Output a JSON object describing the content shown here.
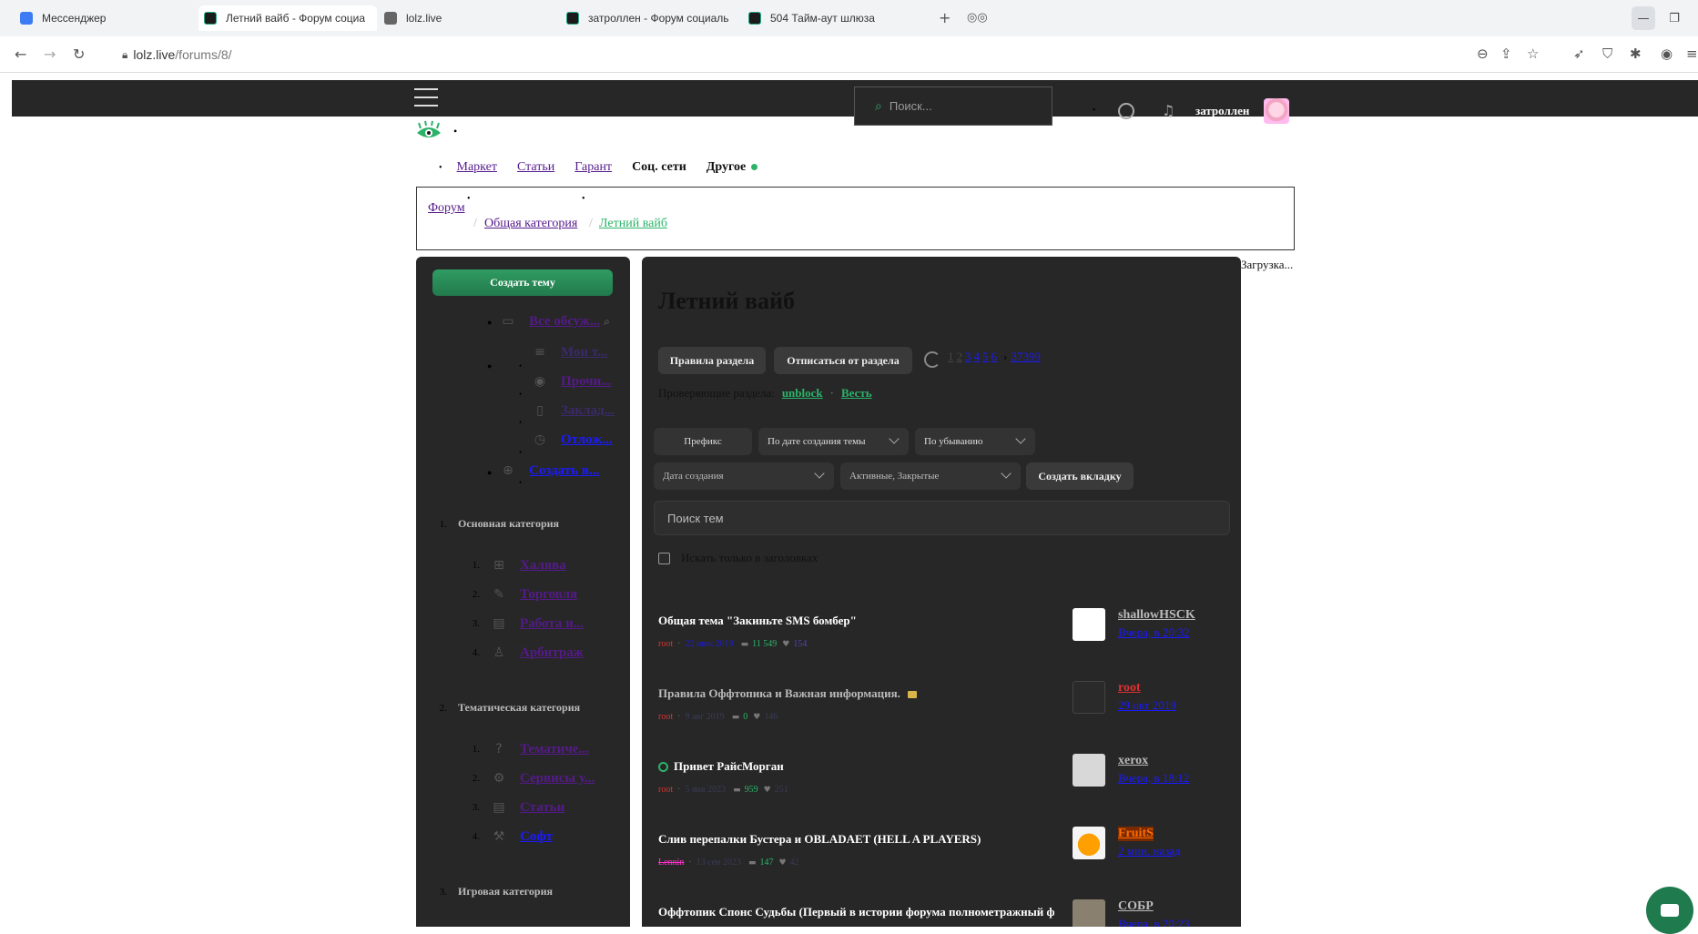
{
  "browser": {
    "tabs": [
      {
        "title": "Мессенджер",
        "icon": "messenger-icon"
      },
      {
        "title": "Летний вайб - Форум социа",
        "icon": "lolz-icon",
        "active": true
      },
      {
        "title": "lolz.live",
        "icon": "page-icon"
      },
      {
        "title": "затроллен - Форум социаль",
        "icon": "lolz-icon"
      },
      {
        "title": "504 Тайм-аут шлюза",
        "icon": "lolz-icon"
      }
    ],
    "url_host": "lolz.live",
    "url_path": "/forums/8/"
  },
  "header": {
    "search_placeholder": "Поиск...",
    "username": "затроллен"
  },
  "nav": {
    "items": [
      {
        "label": "Маркет",
        "link": true
      },
      {
        "label": "Статьи",
        "link": true
      },
      {
        "label": "Гарант",
        "link": true
      },
      {
        "label": "Соц. сети",
        "link": false
      },
      {
        "label": "Другое",
        "link": false
      }
    ]
  },
  "breadcrumbs": {
    "root": "Форум",
    "category": "Общая категория",
    "current": "Летний вайб",
    "sep": "/"
  },
  "sidebar": {
    "create_topic": "Создать тему",
    "top_links": [
      {
        "label": "Все обсуж...",
        "icon": "chat-icon"
      },
      {
        "label": "Мои т...",
        "icon": "lines-icon"
      },
      {
        "label": "Прочи...",
        "icon": "eye-icon"
      },
      {
        "label": "Заклад...",
        "icon": "bookmark-icon"
      },
      {
        "label": "Отлож...",
        "icon": "clock-icon"
      },
      {
        "label": "Создать в...",
        "icon": "plus-circle-icon"
      }
    ],
    "sections": [
      {
        "num": "1.",
        "title": "Основная категория",
        "items": [
          {
            "num": "1.",
            "label": "Халява",
            "icon": "gift-icon"
          },
          {
            "num": "2.",
            "label": "Торговля",
            "icon": "tag-icon"
          },
          {
            "num": "3.",
            "label": "Работа и...",
            "icon": "clipboard-icon"
          },
          {
            "num": "4.",
            "label": "Арбитраж",
            "icon": "user-icon"
          }
        ]
      },
      {
        "num": "2.",
        "title": "Тематическая категория",
        "items": [
          {
            "num": "1.",
            "label": "Тематиче...",
            "icon": "question-icon"
          },
          {
            "num": "2.",
            "label": "Сервисы у...",
            "icon": "settings-icon"
          },
          {
            "num": "3.",
            "label": "Статьи",
            "icon": "document-icon"
          },
          {
            "num": "4.",
            "label": "Софт",
            "icon": "wrench-icon"
          }
        ]
      },
      {
        "num": "3.",
        "title": "Игровая категория",
        "items": []
      }
    ]
  },
  "main": {
    "loading": "Загрузка...",
    "title": "Летний вайб",
    "rules_btn": "Правила раздела",
    "unsubscribe_btn": "Отписаться от раздела",
    "pagination": {
      "pages": [
        "1",
        "2",
        "3",
        "4",
        "5",
        "6"
      ],
      "last": "37399"
    },
    "moderators_label": "Проверяющие раздела:",
    "moderators": [
      "unblock",
      "Весть"
    ],
    "filters": {
      "prefix": "Префикс",
      "sort": "По дате создания темы",
      "order": "По убыванию",
      "date": "Дата создания",
      "state": "Активные, Закрытые",
      "create_tab": "Создать вкладку"
    },
    "topic_search_placeholder": "Поиск тем",
    "title_only": "Искать только в заголовках",
    "threads": [
      {
        "title": "Общая тема \"Закиньте SMS бомбер\"",
        "author": "root",
        "date": "22 июн 2019",
        "replies": "11 549",
        "likes": "154",
        "last_user": "shallowHSCK",
        "last_date": "Вчера, в 20:32",
        "avatar": "#ffffff"
      },
      {
        "title": "Правила Оффтопика и Важная информация.",
        "author": "root",
        "date": "9 авг 2019",
        "replies": "0",
        "likes": "146",
        "last_user": "root",
        "last_date": "29 окт 2019",
        "avatar": "#2a2a2a"
      },
      {
        "title": "Привет РайсМорган",
        "author": "root",
        "date": "5 янв 2023",
        "replies": "959",
        "likes": "251",
        "last_user": "xerox",
        "last_date": "Вчера, в 18:12",
        "avatar": "#d8d8d8"
      },
      {
        "title": "Слив перепалки Бустера и OBLADAET (HELL A PLAYERS)",
        "author": "Lennin",
        "date": "13 сен 2023",
        "replies": "147",
        "likes": "42",
        "last_user": "FruitS",
        "last_date": "2 мин. назад",
        "avatar": "#f5a000"
      },
      {
        "title": "Оффтопик Спонс Судьбы (Первый в истории форума полнометражный фильм)",
        "author": "",
        "date": "",
        "replies": "",
        "likes": "",
        "last_user": "СОБР",
        "last_date": "Вчера, в 20:23",
        "avatar": "#8a8070"
      }
    ]
  },
  "colors": {
    "accent": "#2bb36a",
    "panel": "#272727",
    "link": "#551a8b"
  }
}
